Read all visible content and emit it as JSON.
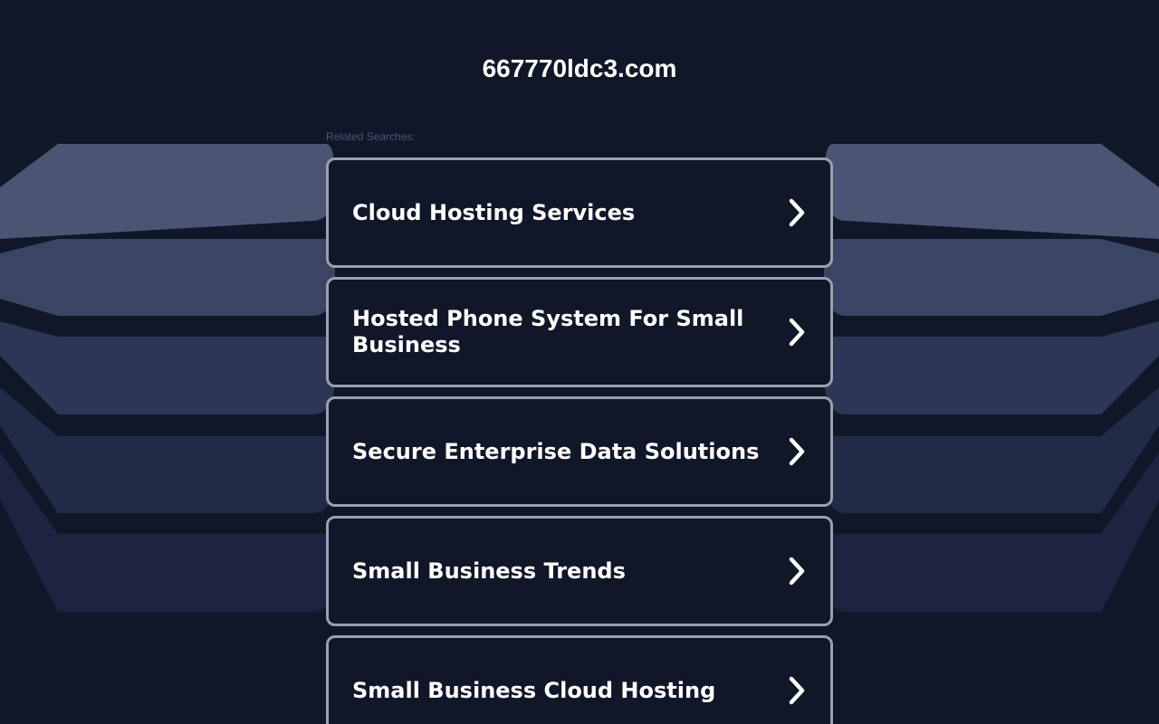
{
  "header": {
    "domain": "667770ldc3.com",
    "related_label": "Related Searches:"
  },
  "links": [
    {
      "label": "Cloud Hosting Services",
      "icon": "chevron-right-icon"
    },
    {
      "label": "Hosted Phone System For Small Business",
      "icon": "chevron-right-icon"
    },
    {
      "label": "Secure Enterprise Data Solutions",
      "icon": "chevron-right-icon"
    },
    {
      "label": "Small Business Trends",
      "icon": "chevron-right-icon"
    },
    {
      "label": "Small Business Cloud Hosting",
      "icon": "chevron-right-icon"
    }
  ],
  "colors": {
    "background": "#101729",
    "band_1": "#4b5573",
    "band_2": "#3a4463",
    "band_3": "#2d3654",
    "band_4": "#212a47",
    "band_5": "#1c2441",
    "card_border": "#9aa0ad",
    "text": "#ffffff",
    "label_text": "#4b5573"
  }
}
